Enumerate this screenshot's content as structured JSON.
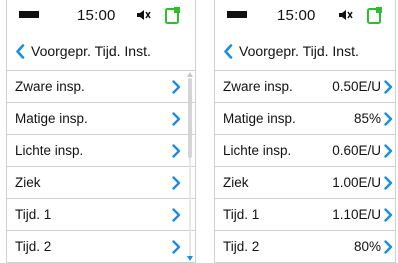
{
  "colors": {
    "accent": "#1a8fe0",
    "cgm": "#2bbf2b",
    "divider": "#cfcfcf"
  },
  "left": {
    "status": {
      "time": "15:00",
      "battery_icon": "battery-icon",
      "speaker_icon": "speaker-icon",
      "cgm_icon": "cgm-icon"
    },
    "title": "Voorgepr. Tijd. Inst.",
    "items": [
      {
        "label": "Zware insp."
      },
      {
        "label": "Matige insp."
      },
      {
        "label": "Lichte insp."
      },
      {
        "label": "Ziek"
      },
      {
        "label": "Tijd. 1"
      },
      {
        "label": "Tijd. 2"
      }
    ],
    "scroll_position": 0.0
  },
  "right": {
    "status": {
      "time": "15:00",
      "battery_icon": "battery-icon",
      "speaker_icon": "speaker-icon",
      "cgm_icon": "cgm-icon"
    },
    "title": "Voorgepr. Tijd. Inst.",
    "items": [
      {
        "label": "Zware insp.",
        "value": "0.50E/U"
      },
      {
        "label": "Matige insp.",
        "value": "85%"
      },
      {
        "label": "Lichte insp.",
        "value": "0.60E/U"
      },
      {
        "label": "Ziek",
        "value": "1.00E/U"
      },
      {
        "label": "Tijd. 1",
        "value": "1.10E/U"
      },
      {
        "label": "Tijd. 2",
        "value": "80%"
      }
    ]
  }
}
